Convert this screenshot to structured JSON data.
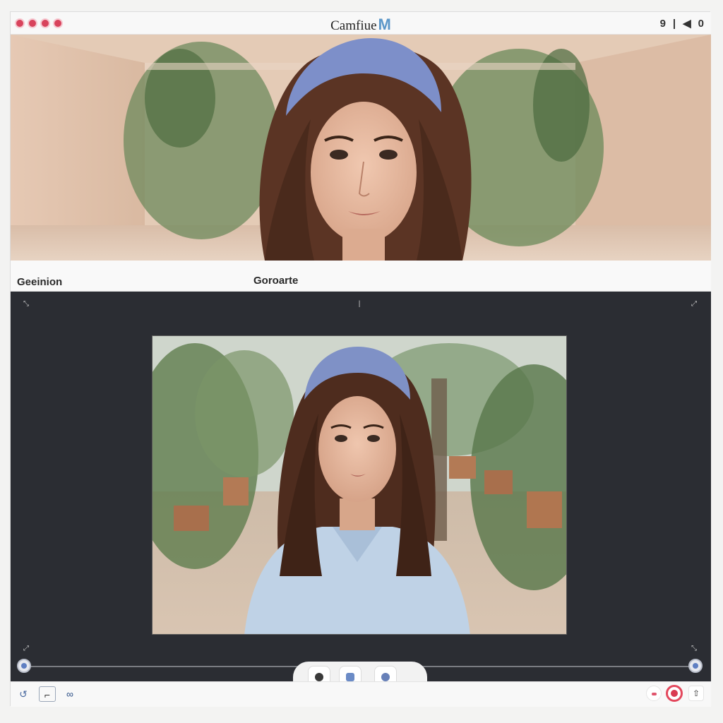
{
  "window": {
    "title": "Camfiue",
    "brand": "M",
    "controls": [
      "9",
      "|",
      "◀",
      "0"
    ]
  },
  "labels": {
    "left": "Geeinion",
    "middle": "Goroarte"
  },
  "canvas": {
    "marker_top": "|"
  },
  "colors": {
    "accent": "#5c97c9",
    "record": "#d93b52",
    "canvas_bg": "#2b2d33"
  },
  "icons": {
    "top_left": "resize-icon",
    "top_right": "expand-icon",
    "bottom_left": "expand-icon",
    "bottom_right": "expand-icon"
  }
}
